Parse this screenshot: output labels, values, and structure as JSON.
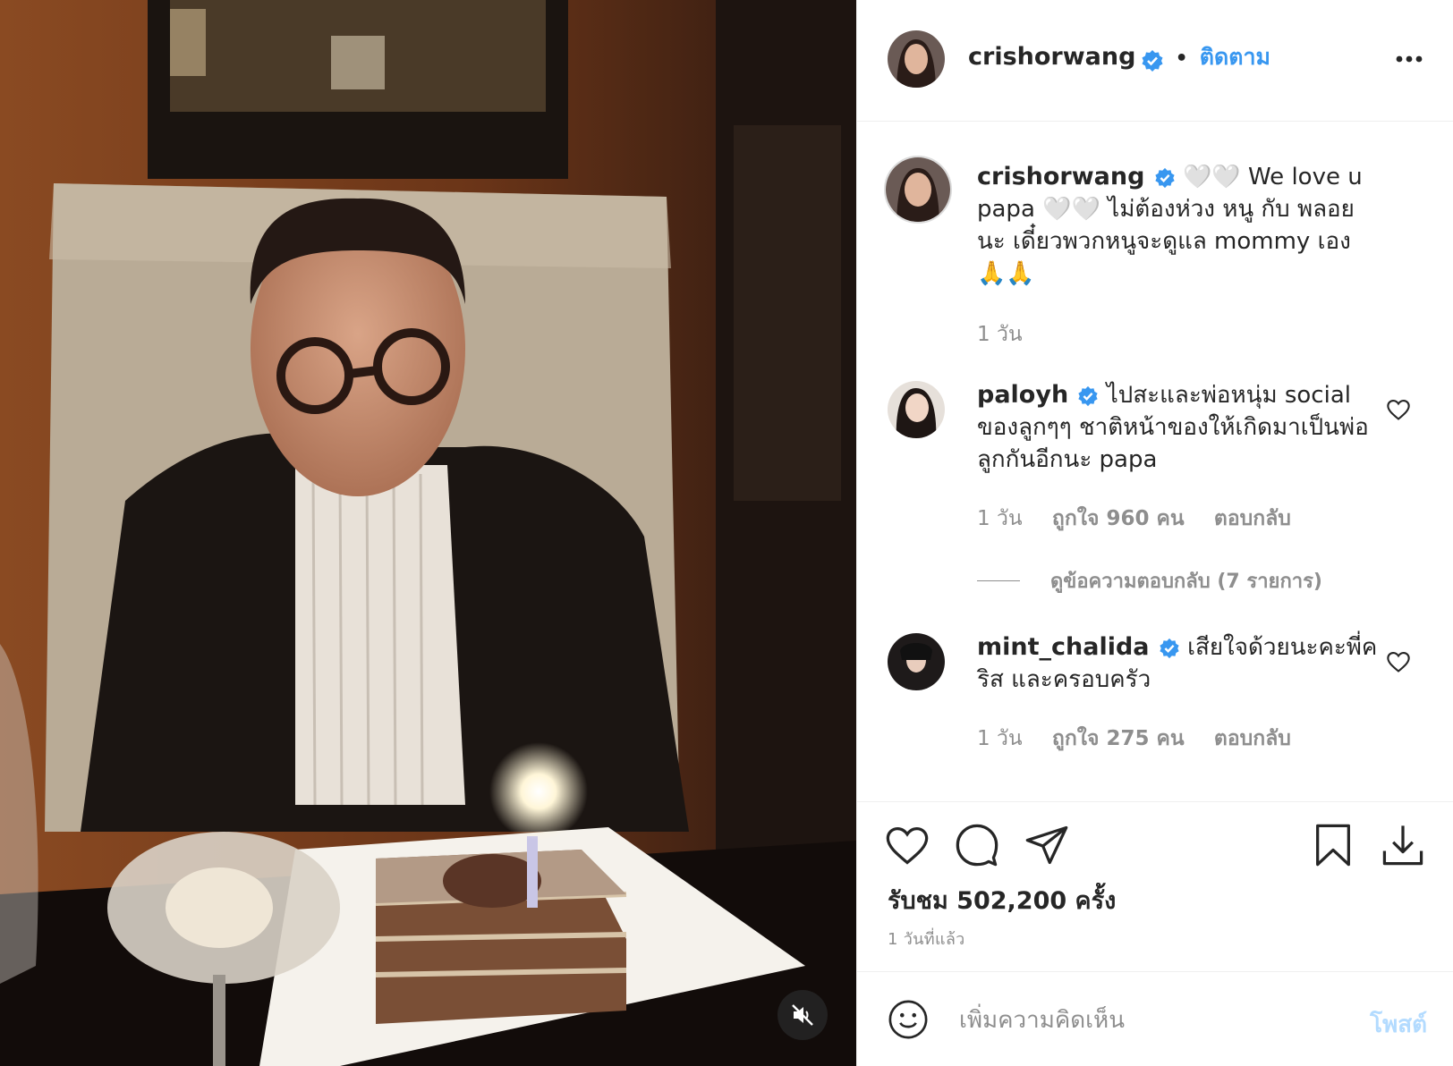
{
  "post": {
    "author": {
      "username": "crishorwang",
      "verified": true,
      "follow_label": "ติดตาม",
      "separator": "•"
    },
    "video": {
      "muted": true,
      "mute_icon": "speaker-muted-icon"
    },
    "caption": {
      "username": "crishorwang",
      "text": "🤍🤍 We love u papa 🤍🤍 ไม่ต้องห่วง หนู กับ พลอย นะ เดี๋ยวพวกหนูจะดูแล mommy เอง 🙏🙏",
      "time": "1 วัน"
    },
    "comments": [
      {
        "username": "paloyh",
        "verified": true,
        "text": "ไปสะและพ่อหนุ่ม social ของลูกๆๆ ชาติหน้าของให้เกิดมาเป็นพ่อลูกกันอีกนะ papa",
        "time": "1 วัน",
        "likes": "ถูกใจ 960 คน",
        "reply_label": "ตอบกลับ",
        "view_replies": "ดูข้อความตอบกลับ (7 รายการ)"
      },
      {
        "username": "mint_chalida",
        "verified": true,
        "text": "เสียใจด้วยนะคะพี่คริส และครอบครัว",
        "time": "1 วัน",
        "likes": "ถูกใจ 275 คน",
        "reply_label": "ตอบกลับ"
      }
    ],
    "stats": {
      "views": "รับชม 502,200 ครั้ง",
      "posted": "1 วันที่แล้ว"
    },
    "add_comment": {
      "placeholder": "เพิ่มความคิดเห็น",
      "post_label": "โพสต์"
    }
  },
  "icons": {
    "more": "more-options-icon",
    "like": "heart-icon",
    "comment": "comment-bubble-icon",
    "share": "paper-plane-icon",
    "save": "bookmark-icon",
    "download": "download-icon",
    "emoji": "emoji-smile-icon"
  },
  "colors": {
    "accent": "#3897f0",
    "verified": "#3897f0",
    "muted_text": "#8e8e8e",
    "post_disabled": "#b3dbff"
  }
}
